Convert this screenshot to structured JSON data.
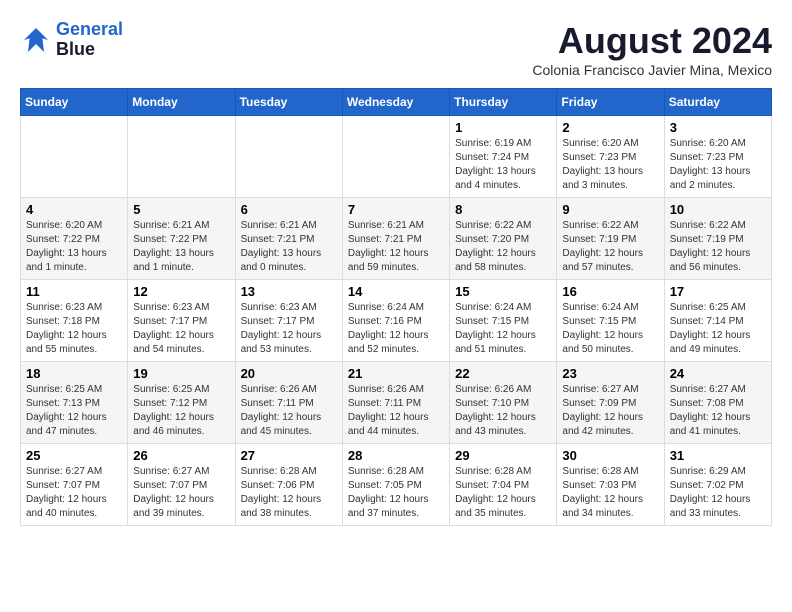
{
  "header": {
    "logo_line1": "General",
    "logo_line2": "Blue",
    "month_year": "August 2024",
    "location": "Colonia Francisco Javier Mina, Mexico"
  },
  "weekdays": [
    "Sunday",
    "Monday",
    "Tuesday",
    "Wednesday",
    "Thursday",
    "Friday",
    "Saturday"
  ],
  "weeks": [
    [
      {
        "day": "",
        "info": ""
      },
      {
        "day": "",
        "info": ""
      },
      {
        "day": "",
        "info": ""
      },
      {
        "day": "",
        "info": ""
      },
      {
        "day": "1",
        "info": "Sunrise: 6:19 AM\nSunset: 7:24 PM\nDaylight: 13 hours\nand 4 minutes."
      },
      {
        "day": "2",
        "info": "Sunrise: 6:20 AM\nSunset: 7:23 PM\nDaylight: 13 hours\nand 3 minutes."
      },
      {
        "day": "3",
        "info": "Sunrise: 6:20 AM\nSunset: 7:23 PM\nDaylight: 13 hours\nand 2 minutes."
      }
    ],
    [
      {
        "day": "4",
        "info": "Sunrise: 6:20 AM\nSunset: 7:22 PM\nDaylight: 13 hours\nand 1 minute."
      },
      {
        "day": "5",
        "info": "Sunrise: 6:21 AM\nSunset: 7:22 PM\nDaylight: 13 hours\nand 1 minute."
      },
      {
        "day": "6",
        "info": "Sunrise: 6:21 AM\nSunset: 7:21 PM\nDaylight: 13 hours\nand 0 minutes."
      },
      {
        "day": "7",
        "info": "Sunrise: 6:21 AM\nSunset: 7:21 PM\nDaylight: 12 hours\nand 59 minutes."
      },
      {
        "day": "8",
        "info": "Sunrise: 6:22 AM\nSunset: 7:20 PM\nDaylight: 12 hours\nand 58 minutes."
      },
      {
        "day": "9",
        "info": "Sunrise: 6:22 AM\nSunset: 7:19 PM\nDaylight: 12 hours\nand 57 minutes."
      },
      {
        "day": "10",
        "info": "Sunrise: 6:22 AM\nSunset: 7:19 PM\nDaylight: 12 hours\nand 56 minutes."
      }
    ],
    [
      {
        "day": "11",
        "info": "Sunrise: 6:23 AM\nSunset: 7:18 PM\nDaylight: 12 hours\nand 55 minutes."
      },
      {
        "day": "12",
        "info": "Sunrise: 6:23 AM\nSunset: 7:17 PM\nDaylight: 12 hours\nand 54 minutes."
      },
      {
        "day": "13",
        "info": "Sunrise: 6:23 AM\nSunset: 7:17 PM\nDaylight: 12 hours\nand 53 minutes."
      },
      {
        "day": "14",
        "info": "Sunrise: 6:24 AM\nSunset: 7:16 PM\nDaylight: 12 hours\nand 52 minutes."
      },
      {
        "day": "15",
        "info": "Sunrise: 6:24 AM\nSunset: 7:15 PM\nDaylight: 12 hours\nand 51 minutes."
      },
      {
        "day": "16",
        "info": "Sunrise: 6:24 AM\nSunset: 7:15 PM\nDaylight: 12 hours\nand 50 minutes."
      },
      {
        "day": "17",
        "info": "Sunrise: 6:25 AM\nSunset: 7:14 PM\nDaylight: 12 hours\nand 49 minutes."
      }
    ],
    [
      {
        "day": "18",
        "info": "Sunrise: 6:25 AM\nSunset: 7:13 PM\nDaylight: 12 hours\nand 47 minutes."
      },
      {
        "day": "19",
        "info": "Sunrise: 6:25 AM\nSunset: 7:12 PM\nDaylight: 12 hours\nand 46 minutes."
      },
      {
        "day": "20",
        "info": "Sunrise: 6:26 AM\nSunset: 7:11 PM\nDaylight: 12 hours\nand 45 minutes."
      },
      {
        "day": "21",
        "info": "Sunrise: 6:26 AM\nSunset: 7:11 PM\nDaylight: 12 hours\nand 44 minutes."
      },
      {
        "day": "22",
        "info": "Sunrise: 6:26 AM\nSunset: 7:10 PM\nDaylight: 12 hours\nand 43 minutes."
      },
      {
        "day": "23",
        "info": "Sunrise: 6:27 AM\nSunset: 7:09 PM\nDaylight: 12 hours\nand 42 minutes."
      },
      {
        "day": "24",
        "info": "Sunrise: 6:27 AM\nSunset: 7:08 PM\nDaylight: 12 hours\nand 41 minutes."
      }
    ],
    [
      {
        "day": "25",
        "info": "Sunrise: 6:27 AM\nSunset: 7:07 PM\nDaylight: 12 hours\nand 40 minutes."
      },
      {
        "day": "26",
        "info": "Sunrise: 6:27 AM\nSunset: 7:07 PM\nDaylight: 12 hours\nand 39 minutes."
      },
      {
        "day": "27",
        "info": "Sunrise: 6:28 AM\nSunset: 7:06 PM\nDaylight: 12 hours\nand 38 minutes."
      },
      {
        "day": "28",
        "info": "Sunrise: 6:28 AM\nSunset: 7:05 PM\nDaylight: 12 hours\nand 37 minutes."
      },
      {
        "day": "29",
        "info": "Sunrise: 6:28 AM\nSunset: 7:04 PM\nDaylight: 12 hours\nand 35 minutes."
      },
      {
        "day": "30",
        "info": "Sunrise: 6:28 AM\nSunset: 7:03 PM\nDaylight: 12 hours\nand 34 minutes."
      },
      {
        "day": "31",
        "info": "Sunrise: 6:29 AM\nSunset: 7:02 PM\nDaylight: 12 hours\nand 33 minutes."
      }
    ]
  ]
}
